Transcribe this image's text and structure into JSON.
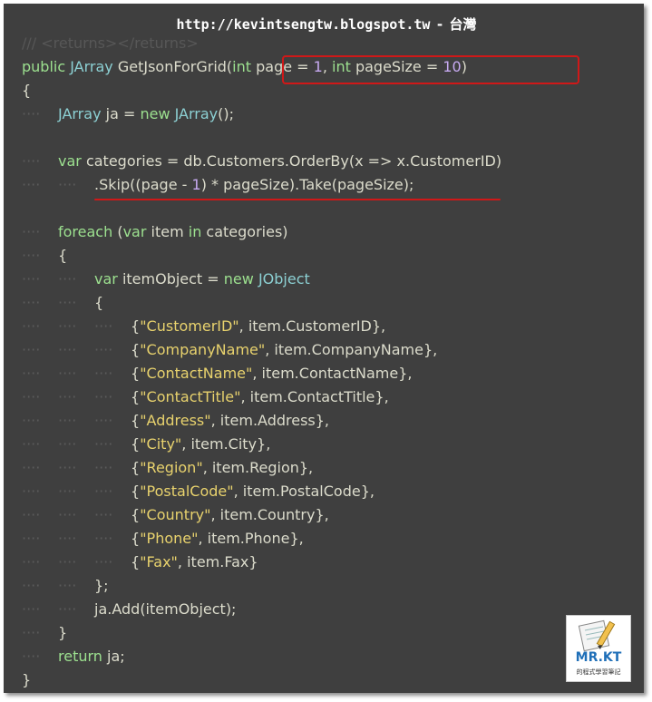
{
  "header": {
    "url": "http://kevintsengtw.blogspot.tw",
    "separator": "-",
    "region": "台灣"
  },
  "code": {
    "ghost_line": "/// <returns></returns>",
    "lines": [
      {
        "indent": 0,
        "tokens": [
          {
            "t": "public ",
            "c": "kw"
          },
          {
            "t": "JArray",
            "c": "type"
          },
          {
            "t": " GetJsonForGrid(",
            "c": "plain"
          },
          {
            "t": "int",
            "c": "kw"
          },
          {
            "t": " page = ",
            "c": "plain"
          },
          {
            "t": "1",
            "c": "num"
          },
          {
            "t": ", ",
            "c": "plain"
          },
          {
            "t": "int",
            "c": "kw"
          },
          {
            "t": " pageSize = ",
            "c": "plain"
          },
          {
            "t": "10",
            "c": "num"
          },
          {
            "t": ")",
            "c": "plain"
          }
        ]
      },
      {
        "indent": 0,
        "tokens": [
          {
            "t": "{",
            "c": "plain"
          }
        ]
      },
      {
        "indent": 1,
        "tokens": [
          {
            "t": "JArray",
            "c": "type"
          },
          {
            "t": " ja = ",
            "c": "plain"
          },
          {
            "t": "new ",
            "c": "kw"
          },
          {
            "t": "JArray",
            "c": "type"
          },
          {
            "t": "();",
            "c": "plain"
          }
        ]
      },
      {
        "indent": 0,
        "tokens": []
      },
      {
        "indent": 1,
        "tokens": [
          {
            "t": "var",
            "c": "kw"
          },
          {
            "t": " categories = db.Customers.OrderBy(x => x.CustomerID)",
            "c": "plain"
          }
        ]
      },
      {
        "indent": 2,
        "tokens": [
          {
            "t": ".Skip((page - ",
            "c": "plain"
          },
          {
            "t": "1",
            "c": "num"
          },
          {
            "t": ") * pageSize).Take(pageSize);",
            "c": "plain"
          }
        ]
      },
      {
        "indent": 0,
        "tokens": []
      },
      {
        "indent": 1,
        "tokens": [
          {
            "t": "foreach",
            "c": "kw"
          },
          {
            "t": " (",
            "c": "plain"
          },
          {
            "t": "var",
            "c": "kw"
          },
          {
            "t": " item ",
            "c": "plain"
          },
          {
            "t": "in",
            "c": "kw"
          },
          {
            "t": " categories)",
            "c": "plain"
          }
        ]
      },
      {
        "indent": 1,
        "tokens": [
          {
            "t": "{",
            "c": "plain"
          }
        ]
      },
      {
        "indent": 2,
        "tokens": [
          {
            "t": "var",
            "c": "kw"
          },
          {
            "t": " itemObject = ",
            "c": "plain"
          },
          {
            "t": "new ",
            "c": "kw"
          },
          {
            "t": "JObject",
            "c": "type"
          }
        ]
      },
      {
        "indent": 2,
        "tokens": [
          {
            "t": "{",
            "c": "plain"
          }
        ]
      },
      {
        "indent": 3,
        "tokens": [
          {
            "t": "{",
            "c": "plain"
          },
          {
            "t": "\"CustomerID\"",
            "c": "str"
          },
          {
            "t": ", item.CustomerID},",
            "c": "plain"
          }
        ]
      },
      {
        "indent": 3,
        "tokens": [
          {
            "t": "{",
            "c": "plain"
          },
          {
            "t": "\"CompanyName\"",
            "c": "str"
          },
          {
            "t": ", item.CompanyName},",
            "c": "plain"
          }
        ]
      },
      {
        "indent": 3,
        "tokens": [
          {
            "t": "{",
            "c": "plain"
          },
          {
            "t": "\"ContactName\"",
            "c": "str"
          },
          {
            "t": ", item.ContactName},",
            "c": "plain"
          }
        ]
      },
      {
        "indent": 3,
        "tokens": [
          {
            "t": "{",
            "c": "plain"
          },
          {
            "t": "\"ContactTitle\"",
            "c": "str"
          },
          {
            "t": ", item.ContactTitle},",
            "c": "plain"
          }
        ]
      },
      {
        "indent": 3,
        "tokens": [
          {
            "t": "{",
            "c": "plain"
          },
          {
            "t": "\"Address\"",
            "c": "str"
          },
          {
            "t": ", item.Address},",
            "c": "plain"
          }
        ]
      },
      {
        "indent": 3,
        "tokens": [
          {
            "t": "{",
            "c": "plain"
          },
          {
            "t": "\"City\"",
            "c": "str"
          },
          {
            "t": ", item.City},",
            "c": "plain"
          }
        ]
      },
      {
        "indent": 3,
        "tokens": [
          {
            "t": "{",
            "c": "plain"
          },
          {
            "t": "\"Region\"",
            "c": "str"
          },
          {
            "t": ", item.Region},",
            "c": "plain"
          }
        ]
      },
      {
        "indent": 3,
        "tokens": [
          {
            "t": "{",
            "c": "plain"
          },
          {
            "t": "\"PostalCode\"",
            "c": "str"
          },
          {
            "t": ", item.PostalCode},",
            "c": "plain"
          }
        ]
      },
      {
        "indent": 3,
        "tokens": [
          {
            "t": "{",
            "c": "plain"
          },
          {
            "t": "\"Country\"",
            "c": "str"
          },
          {
            "t": ", item.Country},",
            "c": "plain"
          }
        ]
      },
      {
        "indent": 3,
        "tokens": [
          {
            "t": "{",
            "c": "plain"
          },
          {
            "t": "\"Phone\"",
            "c": "str"
          },
          {
            "t": ", item.Phone},",
            "c": "plain"
          }
        ]
      },
      {
        "indent": 3,
        "tokens": [
          {
            "t": "{",
            "c": "plain"
          },
          {
            "t": "\"Fax\"",
            "c": "str"
          },
          {
            "t": ", item.Fax}",
            "c": "plain"
          }
        ]
      },
      {
        "indent": 2,
        "tokens": [
          {
            "t": "};",
            "c": "plain"
          }
        ]
      },
      {
        "indent": 2,
        "tokens": [
          {
            "t": "ja.Add(itemObject);",
            "c": "plain"
          }
        ]
      },
      {
        "indent": 1,
        "tokens": [
          {
            "t": "}",
            "c": "plain"
          }
        ]
      },
      {
        "indent": 1,
        "tokens": [
          {
            "t": "return",
            "c": "kw"
          },
          {
            "t": " ja;",
            "c": "plain"
          }
        ]
      },
      {
        "indent": 0,
        "tokens": [
          {
            "t": "}",
            "c": "plain"
          }
        ]
      }
    ]
  },
  "colors": {
    "background": "#3f3f3f",
    "keyword": "#9ce08f",
    "type": "#8cd0d3",
    "number": "#c7aaf1",
    "string": "#e8d26d",
    "text": "#dcdccc",
    "highlight": "#d01818"
  },
  "logo": {
    "icon": "notebook-pencil-icon",
    "title": "MR.KT",
    "subtitle": "的程式學習筆記"
  }
}
